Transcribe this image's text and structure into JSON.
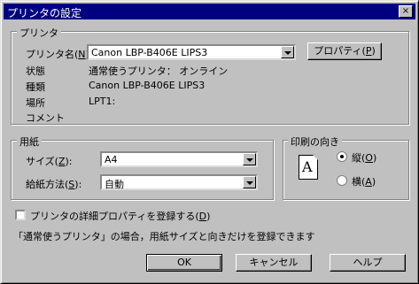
{
  "window": {
    "title": "プリンタの設定",
    "close_glyph": "×"
  },
  "printer_group": {
    "label": "プリンタ",
    "name_label": "プリンタ名(",
    "name_accel": "N",
    "name_close": "):",
    "name_value": "Canon LBP-B406E LIPS3",
    "status_label": "状態",
    "status_value": "通常使うプリンタ： オンライン",
    "type_label": "種類",
    "type_value": "Canon LBP-B406E LIPS3",
    "location_label": "場所",
    "location_value": "LPT1:",
    "comment_label": "コメント",
    "comment_value": "",
    "properties_button": "プロパティ(",
    "properties_accel": "P",
    "properties_close": ")"
  },
  "paper_group": {
    "label": "用紙",
    "size_label": "サイズ(",
    "size_accel": "Z",
    "size_close": "):",
    "size_value": "A4",
    "source_label": "給紙方法(",
    "source_accel": "S",
    "source_close": "):",
    "source_value": "自動"
  },
  "orientation_group": {
    "label": "印刷の向き",
    "icon_letter": "A",
    "portrait_label": "縦(",
    "portrait_accel": "O",
    "portrait_close": ")",
    "landscape_label": "横(",
    "landscape_accel": "A",
    "landscape_close": ")",
    "selected": "portrait"
  },
  "checkbox": {
    "label": "プリンタの詳細プロパティを登録する(",
    "accel": "D",
    "close": ")",
    "checked": false
  },
  "note": "「通常使うプリンタ」の場合，用紙サイズと向きだけを登録できます",
  "buttons": {
    "ok": "OK",
    "cancel": "キャンセル",
    "help": "ヘルプ"
  }
}
